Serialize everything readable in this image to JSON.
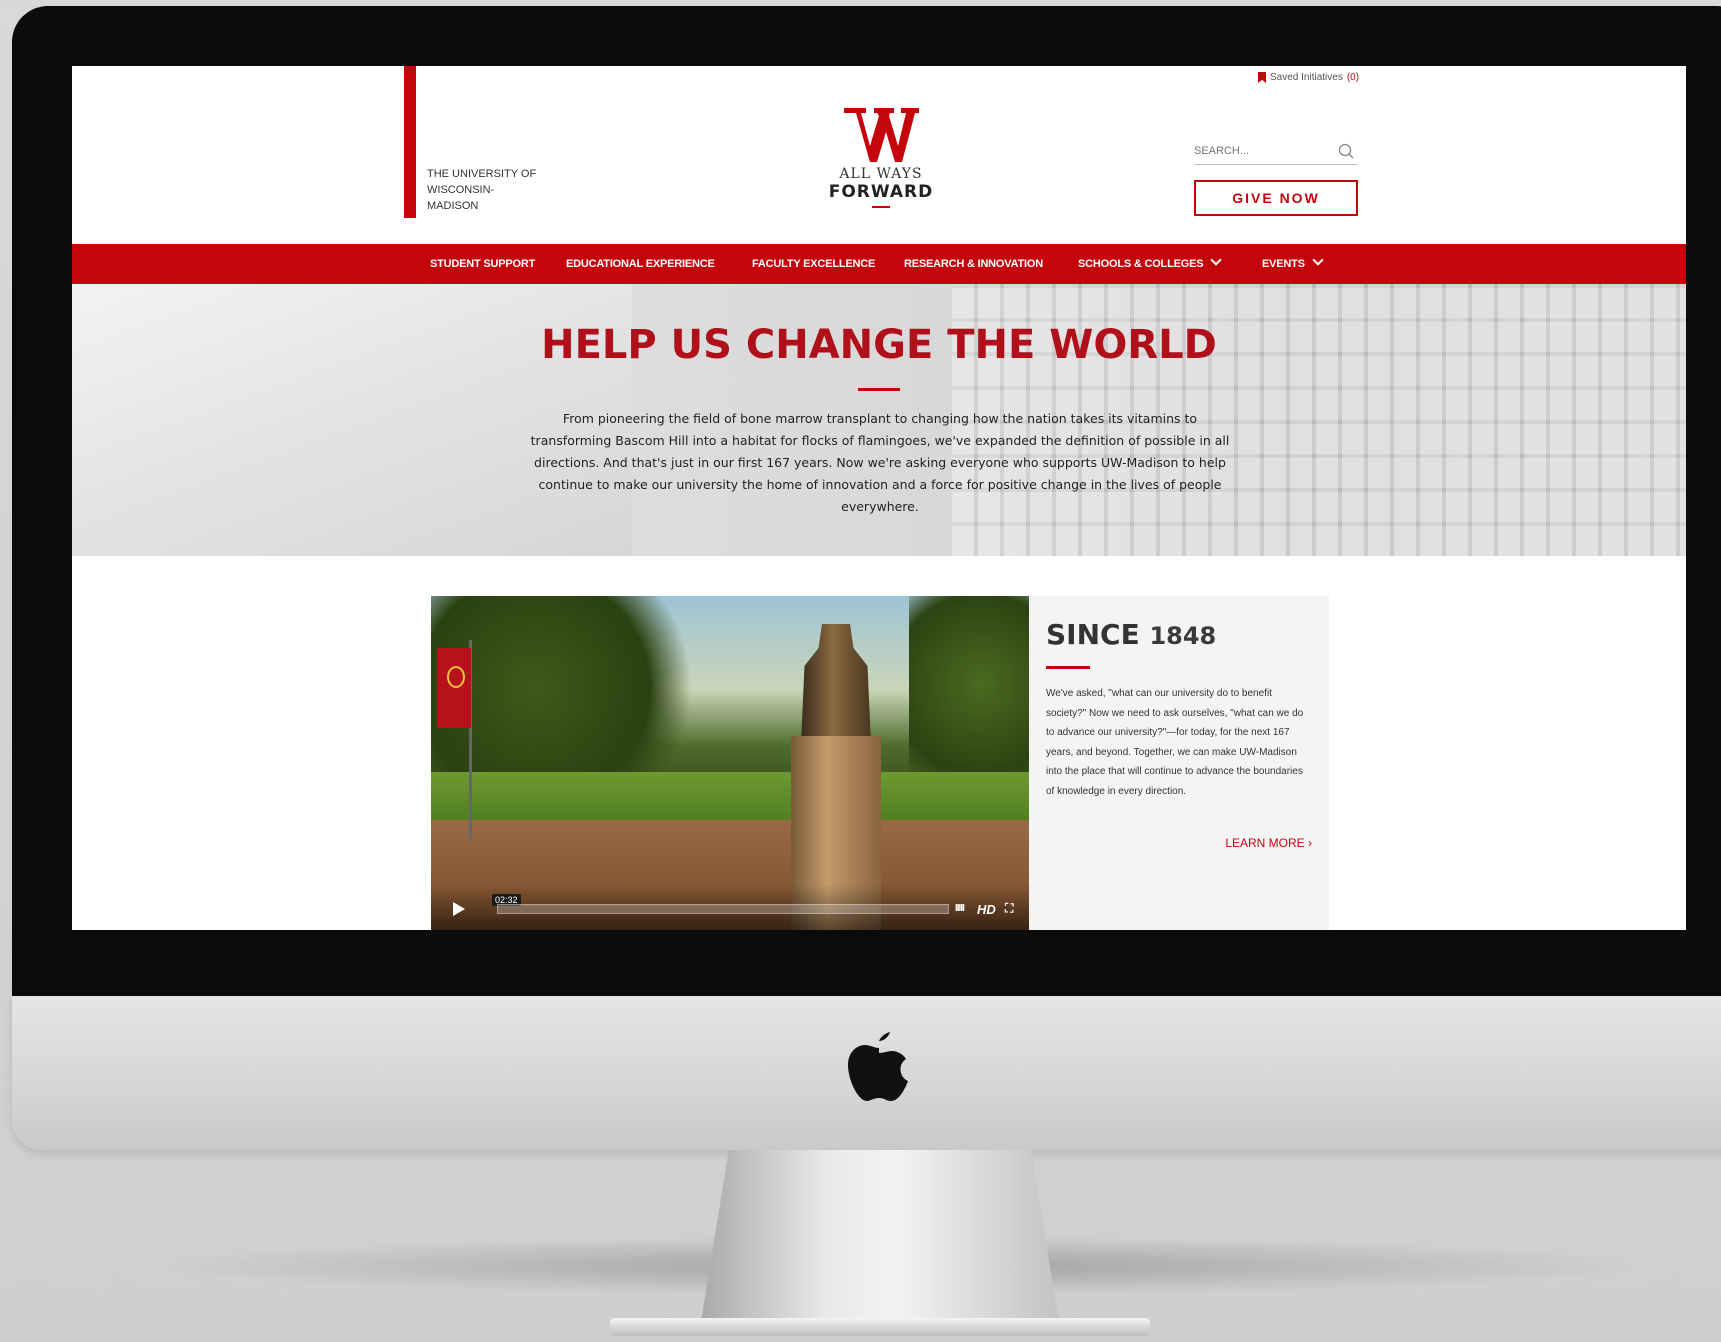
{
  "header": {
    "university_name": "THE UNIVERSITY OF WISCONSIN-MADISON",
    "logo_letter": "W",
    "logo_line1": "ALL WAYS",
    "logo_line2": "FORWARD",
    "saved_label": "Saved Initiatives",
    "saved_count": "(0)",
    "search_placeholder": "SEARCH...",
    "give_now_label": "GIVE NOW"
  },
  "nav": {
    "items": [
      {
        "label": "STUDENT SUPPORT",
        "has_dropdown": false
      },
      {
        "label": "EDUCATIONAL EXPERIENCE",
        "has_dropdown": false
      },
      {
        "label": "FACULTY EXCELLENCE",
        "has_dropdown": false
      },
      {
        "label": "RESEARCH & INNOVATION",
        "has_dropdown": false
      },
      {
        "label": "SCHOOLS & COLLEGES",
        "has_dropdown": true
      },
      {
        "label": "EVENTS",
        "has_dropdown": true
      }
    ]
  },
  "hero": {
    "title": "HELP US CHANGE THE WORLD",
    "text": "From pioneering the field of bone marrow transplant to changing how the nation takes its vitamins to transforming Bascom Hill into a habitat for flocks of flamingoes, we've expanded the definition of possible in all directions. And that's just in our first 167 years. Now we're asking everyone who supports UW-Madison to help continue to make our university the home of innovation and a force for positive change in the lives of people everywhere."
  },
  "video": {
    "duration": "02:32",
    "progress": 0.0,
    "hd_label": "HD",
    "volume_glyph": "IIIII",
    "fullscreen_glyph": "⛶"
  },
  "since": {
    "title_word": "SINCE",
    "title_year": "1848",
    "text": "We've asked, \"what can our university do to benefit society?\" Now we need to ask ourselves, \"what can we do to advance our university?\"—for today, for the next 167 years, and beyond. Together, we can make UW-Madison into the place that will continue to advance the boundaries of knowledge in every direction.",
    "learn_more": "LEARN MORE ›"
  },
  "colors": {
    "brand_red": "#c5050c",
    "nav_text": "#ffffff",
    "bezel": "#0b0b0b"
  },
  "icons": [
    "bookmark-icon",
    "search-icon",
    "chevron-down-icon",
    "play-icon",
    "apple-logo-icon"
  ]
}
